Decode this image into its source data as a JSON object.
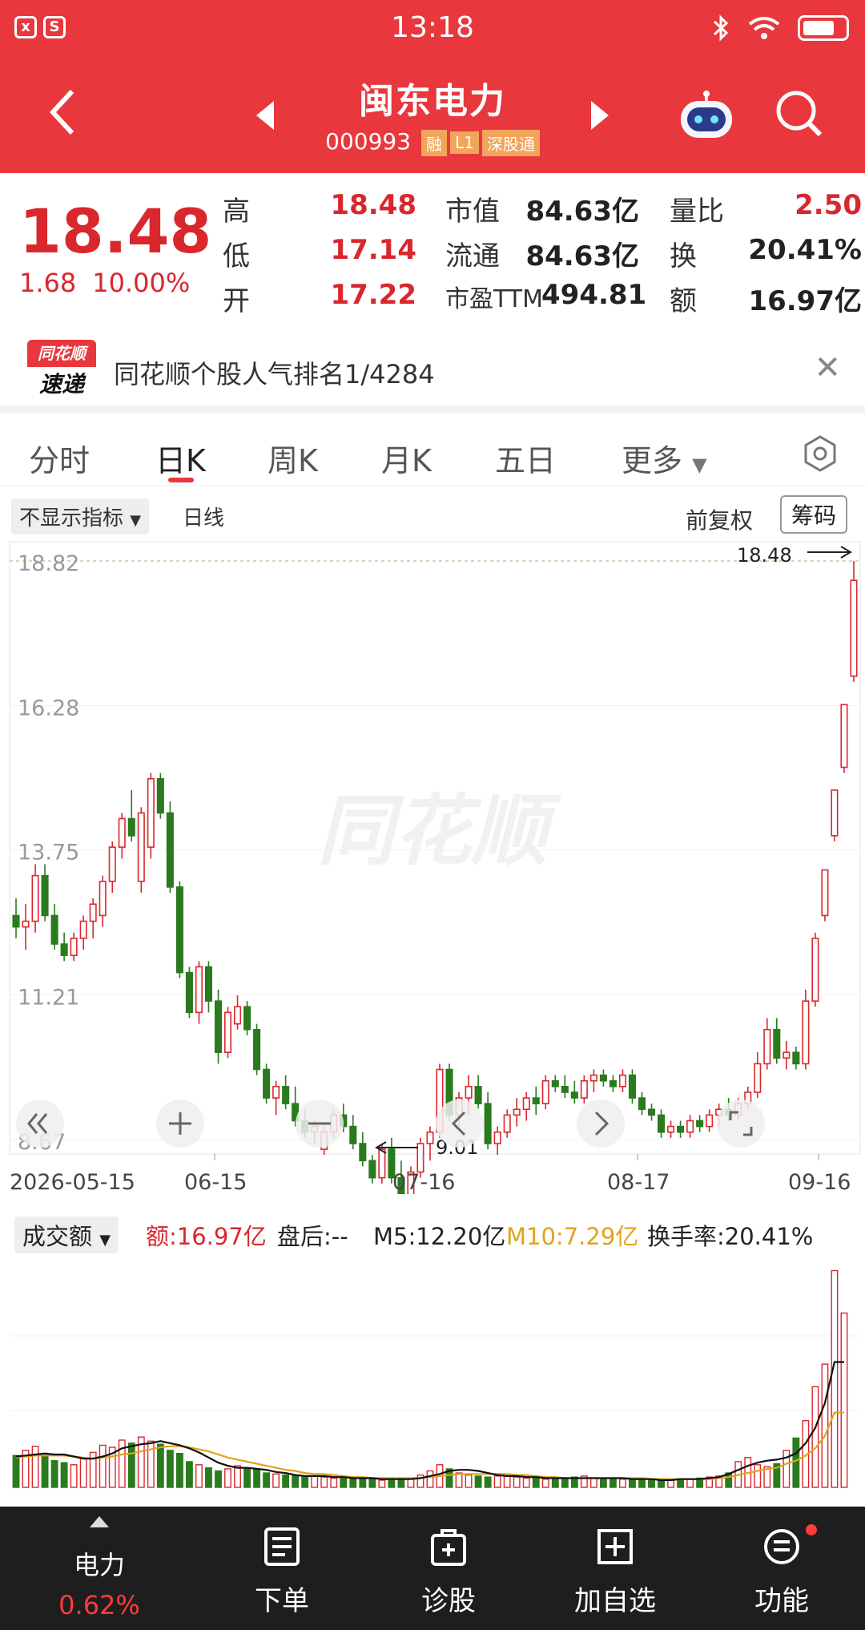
{
  "status_bar": {
    "time": "13:18",
    "app_icon_1": "x",
    "app_icon_2": "S"
  },
  "header": {
    "stock_name": "闽东电力",
    "stock_code": "000993",
    "tags": [
      "融",
      "L1",
      "深股通"
    ]
  },
  "quote": {
    "price": "18.48",
    "change": "1.68",
    "change_pct": "10.00%",
    "high_label": "高",
    "high": "18.48",
    "low_label": "低",
    "low": "17.14",
    "open_label": "开",
    "open": "17.22",
    "mcap_label": "市值",
    "mcap": "84.63亿",
    "float_label": "流通",
    "float": "84.63亿",
    "pe_label": "市盈TTM",
    "pe": "494.81",
    "vol_ratio_label": "量比",
    "vol_ratio": "2.50",
    "turnover_label": "换",
    "turnover": "20.41%",
    "amount_label": "额",
    "amount": "16.97亿"
  },
  "news": {
    "logo_top": "同花顺",
    "logo_bottom": "速递",
    "text": "同花顺个股人气排名1/4284"
  },
  "tabs": [
    "分时",
    "日K",
    "周K",
    "月K",
    "五日",
    "更多"
  ],
  "active_tab": "日K",
  "chart_bar": {
    "indicator": "不显示指标",
    "period": "日线",
    "adjust": "前复权",
    "chips": "筹码"
  },
  "kline_axis": {
    "y_ticks": [
      "18.82",
      "16.28",
      "13.75",
      "11.21",
      "8.67"
    ],
    "x_ticks": [
      "2026-05-15",
      "06-15",
      "07-16",
      "08-17",
      "09-16"
    ],
    "high_marker": "18.48",
    "low_marker": "9.01",
    "watermark": "同花顺"
  },
  "volume_bar": {
    "selector": "成交额",
    "amount": "额:16.97亿",
    "after_hours": "盘后:--",
    "m5": "M5:12.20亿",
    "m10": "M10:7.29亿",
    "turnover": "换手率:20.41%"
  },
  "bottom_nav": {
    "sector": "电力",
    "sector_pct": "0.62%",
    "order": "下单",
    "diagnose": "诊股",
    "add_watch": "加自选",
    "functions": "功能"
  },
  "colors": {
    "up": "#d9272e",
    "down": "#2a7a1e",
    "header": "#e8383d",
    "m5": "#111111",
    "m10": "#e0a31a",
    "turnover": "#2aa3d8"
  },
  "chart_data": {
    "type": "candlestick",
    "ylim": [
      8.67,
      18.82
    ],
    "candles": [
      {
        "o": 12.6,
        "h": 12.9,
        "l": 12.2,
        "c": 12.4
      },
      {
        "o": 12.4,
        "h": 12.8,
        "l": 12.0,
        "c": 12.5
      },
      {
        "o": 12.5,
        "h": 13.5,
        "l": 12.3,
        "c": 13.3
      },
      {
        "o": 13.3,
        "h": 13.5,
        "l": 12.5,
        "c": 12.6
      },
      {
        "o": 12.6,
        "h": 12.8,
        "l": 12.0,
        "c": 12.1
      },
      {
        "o": 12.1,
        "h": 12.3,
        "l": 11.8,
        "c": 11.9
      },
      {
        "o": 11.9,
        "h": 12.3,
        "l": 11.8,
        "c": 12.2
      },
      {
        "o": 12.2,
        "h": 12.6,
        "l": 12.0,
        "c": 12.5
      },
      {
        "o": 12.5,
        "h": 12.9,
        "l": 12.2,
        "c": 12.8
      },
      {
        "o": 12.6,
        "h": 13.3,
        "l": 12.4,
        "c": 13.2
      },
      {
        "o": 13.2,
        "h": 13.9,
        "l": 13.0,
        "c": 13.8
      },
      {
        "o": 13.8,
        "h": 14.4,
        "l": 13.6,
        "c": 14.3
      },
      {
        "o": 14.3,
        "h": 14.8,
        "l": 13.9,
        "c": 14.0
      },
      {
        "o": 13.2,
        "h": 14.5,
        "l": 13.0,
        "c": 14.4
      },
      {
        "o": 13.8,
        "h": 15.1,
        "l": 13.6,
        "c": 15.0
      },
      {
        "o": 15.0,
        "h": 15.1,
        "l": 14.3,
        "c": 14.4
      },
      {
        "o": 14.4,
        "h": 14.6,
        "l": 13.0,
        "c": 13.1
      },
      {
        "o": 13.1,
        "h": 13.2,
        "l": 11.5,
        "c": 11.6
      },
      {
        "o": 11.6,
        "h": 11.7,
        "l": 10.8,
        "c": 10.9
      },
      {
        "o": 10.9,
        "h": 11.8,
        "l": 10.7,
        "c": 11.7
      },
      {
        "o": 11.7,
        "h": 11.8,
        "l": 10.9,
        "c": 11.1
      },
      {
        "o": 11.1,
        "h": 11.3,
        "l": 10.0,
        "c": 10.2
      },
      {
        "o": 10.2,
        "h": 11.0,
        "l": 10.1,
        "c": 10.9
      },
      {
        "o": 10.7,
        "h": 11.2,
        "l": 10.6,
        "c": 11.0
      },
      {
        "o": 11.0,
        "h": 11.1,
        "l": 10.5,
        "c": 10.6
      },
      {
        "o": 10.6,
        "h": 10.7,
        "l": 9.8,
        "c": 9.9
      },
      {
        "o": 9.9,
        "h": 10.0,
        "l": 9.3,
        "c": 9.4
      },
      {
        "o": 9.4,
        "h": 9.7,
        "l": 9.1,
        "c": 9.6
      },
      {
        "o": 9.6,
        "h": 9.8,
        "l": 9.2,
        "c": 9.3
      },
      {
        "o": 9.3,
        "h": 9.6,
        "l": 8.9,
        "c": 9.0
      },
      {
        "o": 9.0,
        "h": 9.2,
        "l": 8.7,
        "c": 8.8
      },
      {
        "o": 8.8,
        "h": 9.0,
        "l": 8.6,
        "c": 8.9
      },
      {
        "o": 8.5,
        "h": 8.9,
        "l": 8.4,
        "c": 8.8
      },
      {
        "o": 8.8,
        "h": 9.2,
        "l": 8.7,
        "c": 9.1
      },
      {
        "o": 9.1,
        "h": 9.3,
        "l": 8.8,
        "c": 8.9
      },
      {
        "o": 8.9,
        "h": 9.1,
        "l": 8.5,
        "c": 8.6
      },
      {
        "o": 8.6,
        "h": 8.8,
        "l": 8.2,
        "c": 8.3
      },
      {
        "o": 8.3,
        "h": 8.4,
        "l": 7.9,
        "c": 8.0
      },
      {
        "o": 8.0,
        "h": 8.6,
        "l": 7.9,
        "c": 8.5
      },
      {
        "o": 8.5,
        "h": 8.7,
        "l": 7.9,
        "c": 8.0
      },
      {
        "o": 8.0,
        "h": 8.3,
        "l": 7.6,
        "c": 7.7
      },
      {
        "o": 7.7,
        "h": 8.2,
        "l": 7.6,
        "c": 8.1
      },
      {
        "o": 8.1,
        "h": 8.7,
        "l": 8.0,
        "c": 8.6
      },
      {
        "o": 8.6,
        "h": 8.9,
        "l": 8.3,
        "c": 8.8
      },
      {
        "o": 8.8,
        "h": 10.0,
        "l": 8.7,
        "c": 9.9
      },
      {
        "o": 9.9,
        "h": 10.0,
        "l": 9.0,
        "c": 9.1
      },
      {
        "o": 9.1,
        "h": 9.5,
        "l": 8.9,
        "c": 9.4
      },
      {
        "o": 9.4,
        "h": 9.8,
        "l": 9.1,
        "c": 9.6
      },
      {
        "o": 9.6,
        "h": 9.8,
        "l": 9.2,
        "c": 9.3
      },
      {
        "o": 9.3,
        "h": 9.5,
        "l": 8.5,
        "c": 8.6
      },
      {
        "o": 8.6,
        "h": 8.9,
        "l": 8.4,
        "c": 8.8
      },
      {
        "o": 8.8,
        "h": 9.2,
        "l": 8.7,
        "c": 9.1
      },
      {
        "o": 9.1,
        "h": 9.4,
        "l": 8.9,
        "c": 9.2
      },
      {
        "o": 9.2,
        "h": 9.5,
        "l": 9.0,
        "c": 9.4
      },
      {
        "o": 9.4,
        "h": 9.6,
        "l": 9.1,
        "c": 9.3
      },
      {
        "o": 9.3,
        "h": 9.8,
        "l": 9.2,
        "c": 9.7
      },
      {
        "o": 9.7,
        "h": 9.8,
        "l": 9.5,
        "c": 9.6
      },
      {
        "o": 9.6,
        "h": 9.8,
        "l": 9.4,
        "c": 9.5
      },
      {
        "o": 9.5,
        "h": 9.7,
        "l": 9.3,
        "c": 9.4
      },
      {
        "o": 9.4,
        "h": 9.8,
        "l": 9.3,
        "c": 9.7
      },
      {
        "o": 9.7,
        "h": 9.9,
        "l": 9.5,
        "c": 9.8
      },
      {
        "o": 9.8,
        "h": 9.9,
        "l": 9.6,
        "c": 9.7
      },
      {
        "o": 9.7,
        "h": 9.8,
        "l": 9.5,
        "c": 9.6
      },
      {
        "o": 9.6,
        "h": 9.9,
        "l": 9.5,
        "c": 9.8
      },
      {
        "o": 9.8,
        "h": 9.9,
        "l": 9.3,
        "c": 9.4
      },
      {
        "o": 9.4,
        "h": 9.5,
        "l": 9.1,
        "c": 9.2
      },
      {
        "o": 9.2,
        "h": 9.3,
        "l": 9.0,
        "c": 9.1
      },
      {
        "o": 9.1,
        "h": 9.2,
        "l": 8.7,
        "c": 8.8
      },
      {
        "o": 8.8,
        "h": 9.0,
        "l": 8.7,
        "c": 8.9
      },
      {
        "o": 8.9,
        "h": 9.0,
        "l": 8.7,
        "c": 8.8
      },
      {
        "o": 8.8,
        "h": 9.1,
        "l": 8.7,
        "c": 9.0
      },
      {
        "o": 9.0,
        "h": 9.1,
        "l": 8.8,
        "c": 8.9
      },
      {
        "o": 8.9,
        "h": 9.2,
        "l": 8.8,
        "c": 9.1
      },
      {
        "o": 9.1,
        "h": 9.3,
        "l": 8.9,
        "c": 9.2
      },
      {
        "o": 9.2,
        "h": 9.4,
        "l": 9.0,
        "c": 9.1
      },
      {
        "o": 9.1,
        "h": 9.4,
        "l": 9.0,
        "c": 9.3
      },
      {
        "o": 9.3,
        "h": 9.6,
        "l": 9.2,
        "c": 9.5
      },
      {
        "o": 9.5,
        "h": 10.2,
        "l": 9.4,
        "c": 10.0
      },
      {
        "o": 10.0,
        "h": 10.8,
        "l": 9.9,
        "c": 10.6
      },
      {
        "o": 10.6,
        "h": 10.8,
        "l": 10.0,
        "c": 10.1
      },
      {
        "o": 10.1,
        "h": 10.4,
        "l": 9.9,
        "c": 10.2
      },
      {
        "o": 10.2,
        "h": 10.3,
        "l": 9.9,
        "c": 10.0
      },
      {
        "o": 10.0,
        "h": 11.3,
        "l": 9.9,
        "c": 11.1
      },
      {
        "o": 11.1,
        "h": 12.3,
        "l": 11.0,
        "c": 12.2
      },
      {
        "o": 12.6,
        "h": 13.4,
        "l": 12.5,
        "c": 13.4
      },
      {
        "o": 14.0,
        "h": 14.8,
        "l": 13.9,
        "c": 14.8
      },
      {
        "o": 15.2,
        "h": 16.3,
        "l": 15.1,
        "c": 16.3
      },
      {
        "o": 16.8,
        "h": 18.82,
        "l": 16.7,
        "c": 18.48
      }
    ],
    "volume_ylim": [
      0,
      22
    ],
    "volume": [
      3.1,
      3.6,
      4.0,
      3.2,
      2.6,
      2.4,
      2.2,
      2.8,
      3.4,
      4.1,
      3.9,
      4.6,
      4.3,
      4.9,
      4.5,
      4.2,
      3.6,
      3.3,
      2.5,
      2.2,
      1.9,
      1.6,
      1.8,
      2.1,
      1.9,
      1.7,
      1.4,
      1.3,
      1.2,
      1.1,
      1.0,
      1.1,
      1.0,
      0.9,
      0.9,
      0.8,
      0.9,
      0.8,
      0.7,
      0.8,
      0.8,
      0.9,
      1.2,
      1.6,
      2.2,
      1.8,
      1.4,
      1.2,
      1.1,
      1.0,
      1.1,
      1.1,
      1.0,
      0.9,
      0.9,
      0.8,
      0.9,
      0.9,
      1.0,
      1.1,
      0.9,
      0.8,
      0.9,
      0.8,
      0.7,
      0.8,
      0.7,
      0.7,
      0.8,
      0.8,
      0.8,
      0.9,
      1.0,
      1.1,
      1.4,
      2.5,
      2.9,
      2.2,
      2.0,
      2.3,
      3.6,
      4.8,
      6.5,
      9.8,
      12.0,
      21.1,
      16.97
    ],
    "m5": [
      3.0,
      3.1,
      3.2,
      3.3,
      3.2,
      3.2,
      3.0,
      2.8,
      2.8,
      3.0,
      3.3,
      3.8,
      4.0,
      4.2,
      4.3,
      4.5,
      4.3,
      4.1,
      3.8,
      3.4,
      2.9,
      2.4,
      2.1,
      1.9,
      1.9,
      1.8,
      1.7,
      1.5,
      1.4,
      1.2,
      1.1,
      1.1,
      1.1,
      1.0,
      1.0,
      0.9,
      0.9,
      0.9,
      0.8,
      0.8,
      0.8,
      0.8,
      0.9,
      1.1,
      1.3,
      1.6,
      1.7,
      1.7,
      1.6,
      1.4,
      1.2,
      1.1,
      1.1,
      1.0,
      1.0,
      0.9,
      0.9,
      0.9,
      0.9,
      0.9,
      0.9,
      0.9,
      0.9,
      0.9,
      0.8,
      0.8,
      0.8,
      0.7,
      0.7,
      0.8,
      0.8,
      0.8,
      0.9,
      1.0,
      1.3,
      1.7,
      2.1,
      2.4,
      2.6,
      2.7,
      2.9,
      3.3,
      4.3,
      5.8,
      8.2,
      12.2,
      12.2
    ],
    "m10": [
      2.9,
      3.0,
      3.1,
      3.1,
      3.1,
      3.1,
      3.0,
      2.9,
      2.8,
      2.9,
      3.0,
      3.2,
      3.3,
      3.5,
      3.7,
      3.9,
      4.0,
      4.0,
      3.9,
      3.7,
      3.5,
      3.2,
      2.9,
      2.7,
      2.5,
      2.3,
      2.1,
      1.9,
      1.7,
      1.6,
      1.4,
      1.3,
      1.3,
      1.2,
      1.1,
      1.0,
      1.0,
      0.9,
      0.9,
      0.9,
      0.9,
      0.9,
      0.9,
      1.0,
      1.1,
      1.2,
      1.3,
      1.3,
      1.3,
      1.3,
      1.3,
      1.3,
      1.2,
      1.2,
      1.1,
      1.0,
      1.0,
      0.9,
      0.9,
      0.9,
      0.9,
      0.9,
      0.9,
      0.9,
      0.9,
      0.9,
      0.8,
      0.8,
      0.8,
      0.8,
      0.8,
      0.8,
      0.8,
      0.9,
      1.0,
      1.2,
      1.4,
      1.6,
      1.8,
      1.9,
      2.3,
      2.6,
      3.1,
      3.8,
      5.0,
      7.29,
      7.29
    ]
  }
}
